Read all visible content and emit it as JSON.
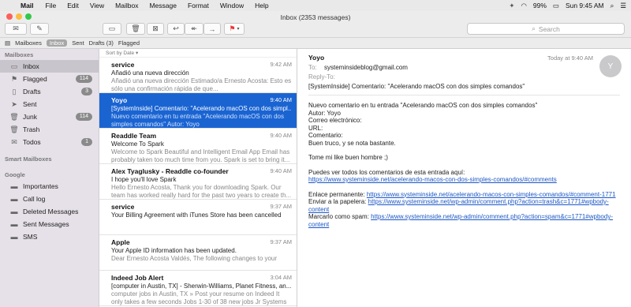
{
  "menubar": {
    "app": "Mail",
    "items": [
      "File",
      "Edit",
      "View",
      "Mailbox",
      "Message",
      "Format",
      "Window",
      "Help"
    ],
    "battery": "99%",
    "clock": "Sun 9:45 AM"
  },
  "window": {
    "title": "Inbox (2353 messages)"
  },
  "search": {
    "placeholder": "Search"
  },
  "favorites": {
    "mailboxes": "Mailboxes",
    "inbox": "Inbox",
    "sent": "Sent",
    "drafts": "Drafts (3)",
    "flagged": "Flagged"
  },
  "sidebar": {
    "mailboxes_header": "Mailboxes",
    "items": [
      {
        "label": "Inbox",
        "count": "",
        "icon": "inbox-icon"
      },
      {
        "label": "Flagged",
        "count": "114",
        "icon": "flag-icon"
      },
      {
        "label": "Drafts",
        "count": "3",
        "icon": "document-icon"
      },
      {
        "label": "Sent",
        "count": "",
        "icon": "paper-plane-icon"
      },
      {
        "label": "Junk",
        "count": "114",
        "icon": "trash-icon"
      },
      {
        "label": "Trash",
        "count": "",
        "icon": "trash-icon"
      },
      {
        "label": "Todos",
        "count": "1",
        "icon": "envelope-icon"
      }
    ],
    "smart_header": "Smart Mailboxes",
    "google_header": "Google",
    "google_items": [
      "Importantes",
      "Call log",
      "Deleted Messages",
      "Sent Messages",
      "SMS"
    ]
  },
  "list": {
    "sort_label": "Sort by Date",
    "messages": [
      {
        "from": "service",
        "time": "9:42 AM",
        "subject": "Añadió una nueva dirección",
        "preview": "Añadió una nueva dirección Estimado/a Ernesto Acosta: Esto es sólo una confirmación rápida de que..."
      },
      {
        "from": "Yoyo",
        "time": "9:40 AM",
        "subject": "[SystemInside] Comentario: \"Acelerando macOS con dos simpl...",
        "preview": "Nuevo comentario en tu entrada \"Acelerando macOS con dos simples comandos\" Autor: Yoyo"
      },
      {
        "from": "Readdle Team",
        "time": "9:40 AM",
        "subject": "Welcome To Spark",
        "preview": "Welcome to Spark Beautiful and Intelligent Email App Email has probably taken too much time from you. Spark is set to bring it..."
      },
      {
        "from": "Alex Tyaglusky - Readdle co-founder",
        "time": "9:40 AM",
        "subject": "I hope you'll love Spark",
        "preview": "Hello Ernesto Acosta, Thank you for downloading Spark. Our team has worked really hard for the past two years to create th..."
      },
      {
        "from": "service",
        "time": "9:37 AM",
        "subject": "Your Billing Agreement with iTunes Store has been cancelled",
        "preview": ""
      },
      {
        "from": "Apple",
        "time": "9:37 AM",
        "subject": "Your Apple ID information has been updated.",
        "preview": "Dear Ernesto Acosta Valdés, The following changes to your"
      },
      {
        "from": "Indeed Job Alert",
        "time": "3:04 AM",
        "subject": "[computer in Austin, TX] - Sherwin-Williams, Planet Fitness, an...",
        "preview": "computer jobs in Austin, TX » Post your resume on Indeed It only takes a few seconds Jobs 1-30 of 38 new jobs Jr Systems Adm..."
      }
    ]
  },
  "reader": {
    "from": "Yoyo",
    "date": "Today at 9:40 AM",
    "to_label": "To:",
    "to_value": "systeminsideblog@gmail.com",
    "replyto_label": "Reply-To:",
    "subject": "[SystemInside] Comentario: \"Acelerando macOS con dos simples comandos\"",
    "avatar": "Y",
    "body": {
      "l1": "Nuevo comentario en tu entrada \"Acelerando macOS con dos simples comandos\"",
      "l2": "Autor: Yoyo",
      "l3": "Correo electrónico:",
      "l4": "URL:",
      "l5": "Comentario:",
      "l6": "Buen truco, y se nota bastante.",
      "l7": "Tome mi like buen hombre ;)",
      "l8": "Puedes ver todos los comentarios de esta entrada aquí:",
      "link1": "https://www.systeminside.net/acelerando-macos-con-dos-simples-comandos/#comments",
      "perm_label": "Enlace permanente:",
      "perm_link": "https://www.systeminside.net/acelerando-macos-con-simples-comandos/#comment-1771",
      "trash_label": "Enviar a la papelera:",
      "trash_link": "https://www.systeminside.net/wp-admin/comment.php?action=trash&c=1771#wpbody-content",
      "spam_label": "Marcarlo como spam:",
      "spam_link": "https://www.systeminside.net/wp-admin/comment.php?action=spam&c=1771#wpbody-content"
    }
  },
  "colors": {
    "selection": "#1a64d2",
    "sidebar": "#e6e1e8",
    "link": "#1b57c5"
  }
}
